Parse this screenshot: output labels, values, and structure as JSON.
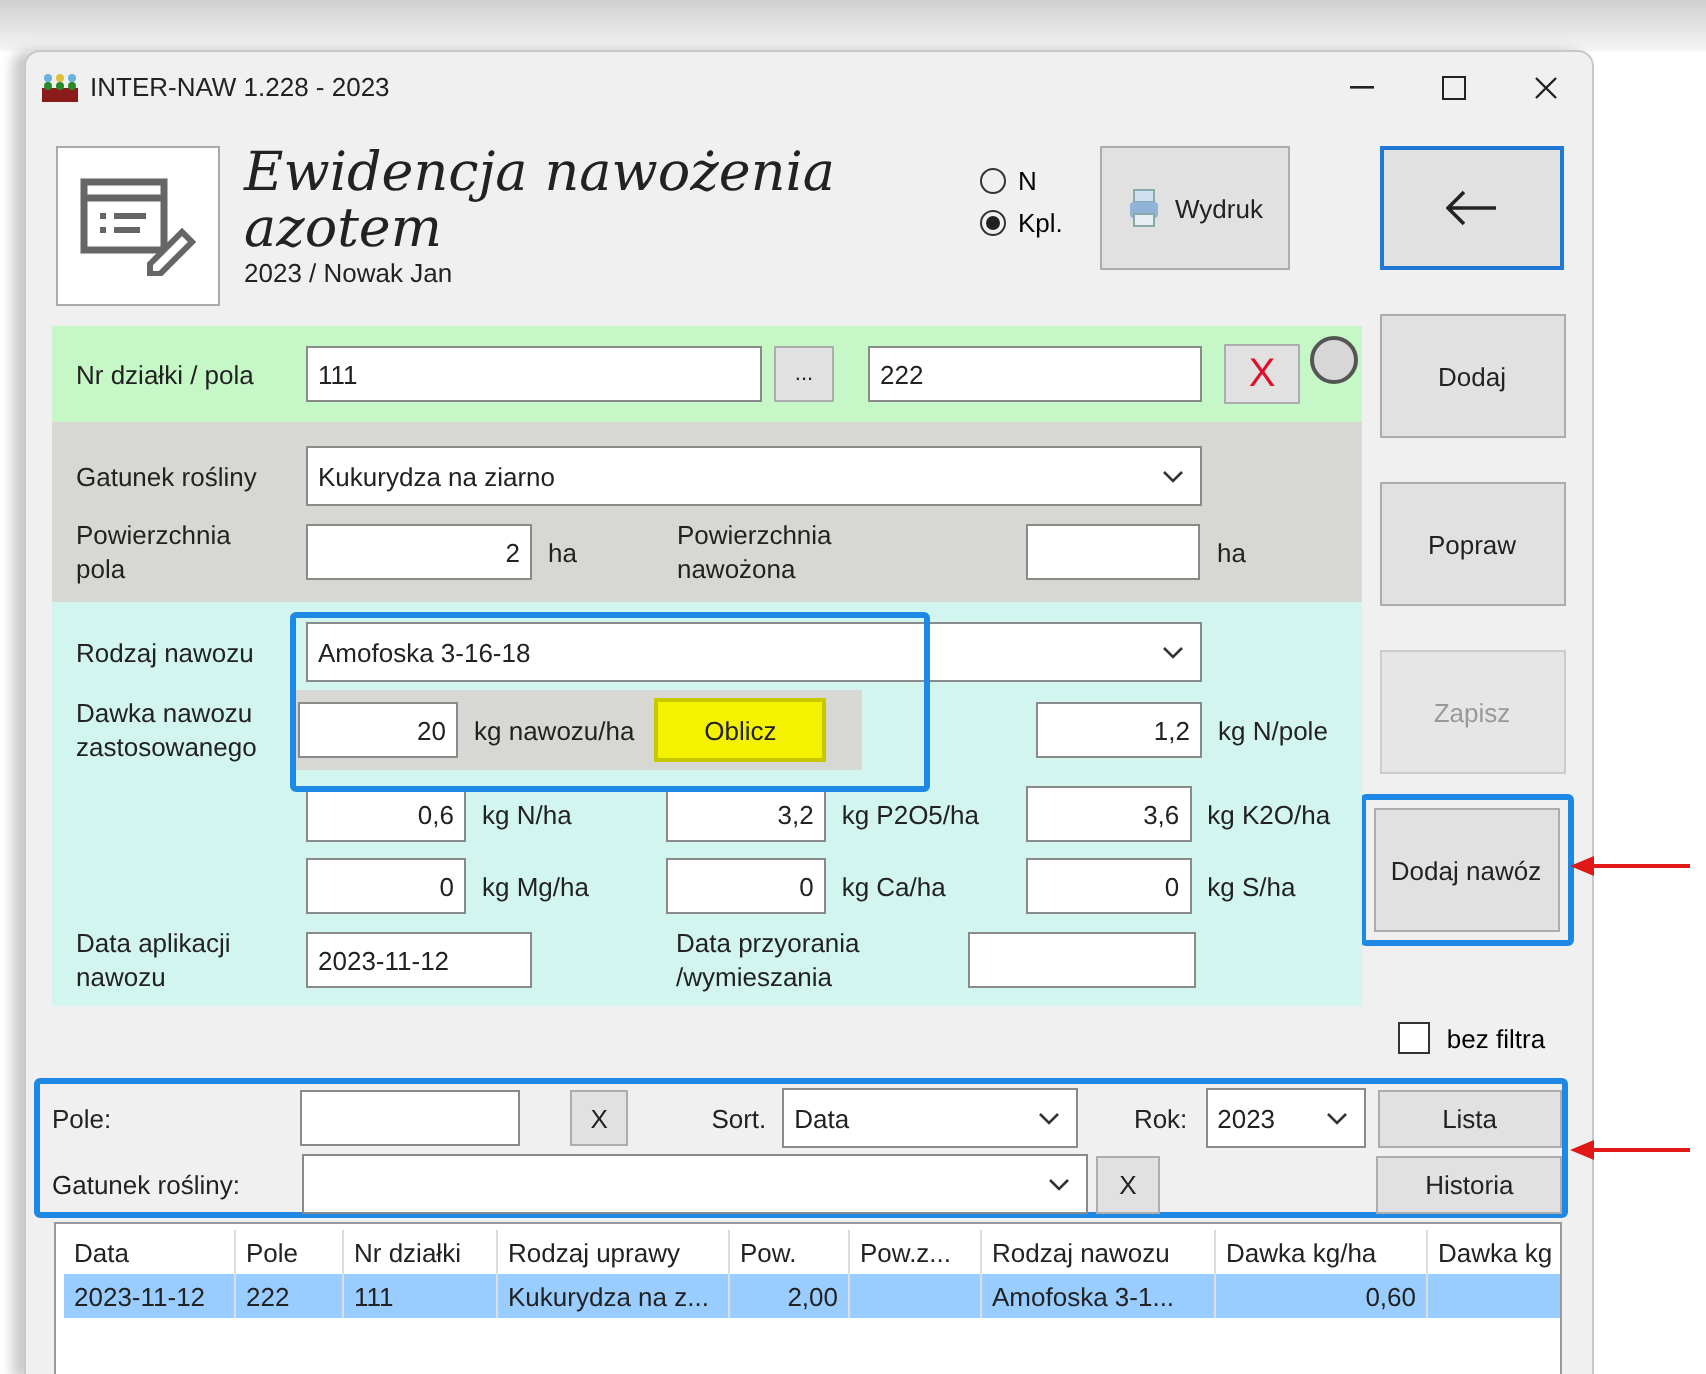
{
  "window": {
    "title": "INTER-NAW 1.228 - 2023"
  },
  "header": {
    "title": "Ewidencja nawożenia azotem",
    "subtitle": "2023 / Nowak Jan"
  },
  "mode_options": [
    {
      "label": "N",
      "selected": false
    },
    {
      "label": "Kpl.",
      "selected": true
    }
  ],
  "print_button": "Wydruk",
  "plot": {
    "label": "Nr działki / pola",
    "plot_number": "111",
    "browse": "...",
    "field": "222",
    "clear": "X"
  },
  "crop": {
    "label": "Gatunek rośliny",
    "value": "Kukurydza na ziarno",
    "area_label": "Powierzchnia pola",
    "area": "2",
    "area_unit": "ha",
    "fert_area_label": "Powierzchnia nawożona",
    "fert_area_unit": "ha"
  },
  "fertilizer": {
    "label": "Rodzaj nawozu",
    "value": "Amofoska  3-16-18",
    "dose_label": "Dawka nawozu zastosowanego",
    "dose": "20",
    "dose_unit": "kg nawozu/ha",
    "calc_button": "Oblicz",
    "n_field": "1,2",
    "n_field_unit": "kg N/pole",
    "nutrients": [
      {
        "value": "0,6",
        "unit": "kg N/ha"
      },
      {
        "value": "3,2",
        "unit": "kg P2O5/ha"
      },
      {
        "value": "3,6",
        "unit": "kg K2O/ha"
      },
      {
        "value": "0",
        "unit": "kg Mg/ha"
      },
      {
        "value": "0",
        "unit": "kg Ca/ha"
      },
      {
        "value": "0",
        "unit": "kg S/ha"
      }
    ],
    "date_label": "Data aplikacji nawozu",
    "date": "2023-11-12",
    "plough_label": "Data przyorania /wymieszania"
  },
  "side_buttons": [
    {
      "label": "Dodaj",
      "disabled": false
    },
    {
      "label": "Popraw",
      "disabled": false
    },
    {
      "label": "Zapisz",
      "disabled": true
    },
    {
      "label": "Dodaj nawóz",
      "disabled": false
    }
  ],
  "no_filter": {
    "label": "bez filtra",
    "checked": false
  },
  "filter": {
    "field_label": "Pole:",
    "clear": "X",
    "sort_label": "Sort.",
    "sort": "Data",
    "year_label": "Rok:",
    "year": "2023",
    "list_button": "Lista",
    "crop_label": "Gatunek rośliny:",
    "crop_clear": "X",
    "history_button": "Historia"
  },
  "table": {
    "columns": [
      "Data",
      "Pole",
      "Nr działki",
      "Rodzaj uprawy",
      "Pow.",
      "Pow.z...",
      "Rodzaj nawozu",
      "Dawka kg/ha",
      "Dawka kg"
    ],
    "rows": [
      {
        "selected": true,
        "cells": [
          "2023-11-12",
          "222",
          "111",
          "Kukurydza na z...",
          "2,00",
          null,
          "Amofoska  3-1...",
          "0,60",
          null
        ]
      }
    ]
  }
}
